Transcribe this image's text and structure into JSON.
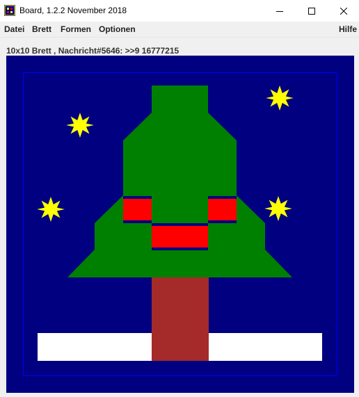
{
  "window": {
    "title": "Board, 1.2.2 November 2018",
    "controls": [
      "minimize",
      "maximize",
      "close"
    ]
  },
  "menu": {
    "items": [
      "Datei",
      "Brett",
      "Formen",
      "Optionen"
    ],
    "help": "Hilfe"
  },
  "status": {
    "message": "10x10 Brett , Nachricht#5646: >>9 16777215"
  },
  "board": {
    "grid_size": "10x10",
    "scene": "christmas-tree",
    "colors": {
      "background": "#000080",
      "frame": "#0000ff",
      "tree": "#008000",
      "trunk": "#a52a2a",
      "snow": "#ffffff",
      "ornament": "#ff0000",
      "ornament_band": "#000080",
      "star": "#ffff00"
    },
    "stars": 4,
    "ornaments": 3
  }
}
